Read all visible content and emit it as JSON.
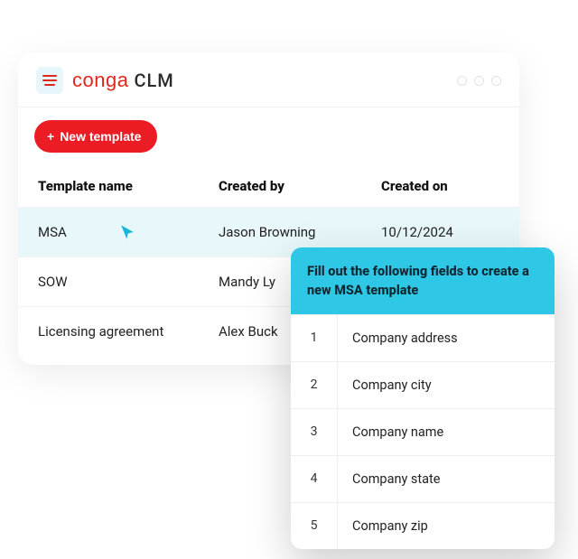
{
  "brand": {
    "name": "conga",
    "product": "CLM"
  },
  "toolbar": {
    "new_template_label": "New template"
  },
  "columns": {
    "name": "Template name",
    "created_by": "Created by",
    "created_on": "Created on"
  },
  "rows": [
    {
      "name": "MSA",
      "by": "Jason Browning",
      "on": "10/12/2024",
      "hover": true
    },
    {
      "name": "SOW",
      "by": "Mandy Ly",
      "on": "",
      "hover": false
    },
    {
      "name": "Licensing agreement",
      "by": "Alex Buck",
      "on": "",
      "hover": false
    }
  ],
  "popup": {
    "title": "Fill out the following fields to create a new MSA template",
    "fields": [
      {
        "n": "1",
        "label": "Company address"
      },
      {
        "n": "2",
        "label": "Company city"
      },
      {
        "n": "3",
        "label": "Company name"
      },
      {
        "n": "4",
        "label": "Company state"
      },
      {
        "n": "5",
        "label": "Company zip"
      }
    ]
  }
}
